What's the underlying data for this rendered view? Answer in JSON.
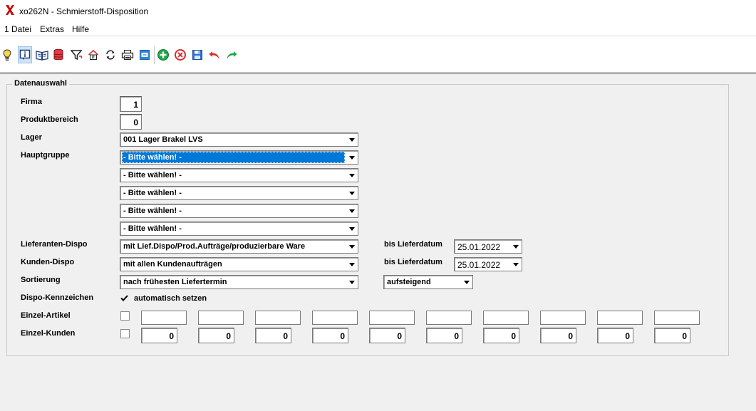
{
  "window": {
    "title": "xo262N - Schmierstoff-Disposition"
  },
  "menu": [
    {
      "id": "datei",
      "label": "1 Datei"
    },
    {
      "id": "extras",
      "label": "Extras"
    },
    {
      "id": "hilfe",
      "label": "Hilfe"
    }
  ],
  "toolbar": [
    "lightbulb-icon",
    "info-icon",
    "book-icon",
    "database-icon",
    "filter-icon",
    "home-icon",
    "refresh-icon",
    "printer-icon",
    "window-icon",
    "add-icon",
    "delete-icon",
    "save-icon",
    "undo-icon",
    "redo-icon"
  ],
  "group": {
    "title": "Datenauswahl"
  },
  "labels": {
    "firma": "Firma",
    "produktbereich": "Produktbereich",
    "lager": "Lager",
    "hauptgruppe": "Hauptgruppe",
    "lieferanten_dispo": "Lieferanten-Dispo",
    "kunden_dispo": "Kunden-Dispo",
    "sortierung": "Sortierung",
    "dispo_kennzeichen": "Dispo-Kennzeichen",
    "einzel_artikel": "Einzel-Artikel",
    "einzel_kunden": "Einzel-Kunden",
    "bis_lieferdatum_1": "bis Lieferdatum",
    "bis_lieferdatum_2": "bis Lieferdatum"
  },
  "fields": {
    "firma": "1",
    "produktbereich": "0",
    "lager": "001 Lager Brakel LVS",
    "hauptgruppe": [
      "- Bitte wählen! -",
      "- Bitte wählen! -",
      "- Bitte wählen! -",
      "- Bitte wählen! -",
      "- Bitte wählen! -"
    ],
    "lieferanten_dispo": "mit Lief.Dispo/Prod.Aufträge/produzierbare Ware",
    "kunden_dispo": "mit allen Kundenaufträgen",
    "sortierung": "nach frühesten Liefertermin",
    "sort_order": "aufsteigend",
    "lieferdatum_1": "25.01.2022",
    "lieferdatum_2": "25.01.2022",
    "dispo_kennzeichen_checked": true,
    "dispo_kennzeichen_label": "automatisch setzen",
    "einzel_artikel_checked": false,
    "einzel_artikel": [
      "",
      "",
      "",
      "",
      "",
      "",
      "",
      "",
      "",
      ""
    ],
    "einzel_kunden_checked": false,
    "einzel_kunden": [
      "0",
      "0",
      "0",
      "0",
      "0",
      "0",
      "0",
      "0",
      "0",
      "0"
    ]
  },
  "colors": {
    "selection": "#0078d7",
    "logo": "#cc0000",
    "add": "#1fa84a",
    "delete": "#d32f2f",
    "save": "#2f6fd1"
  }
}
